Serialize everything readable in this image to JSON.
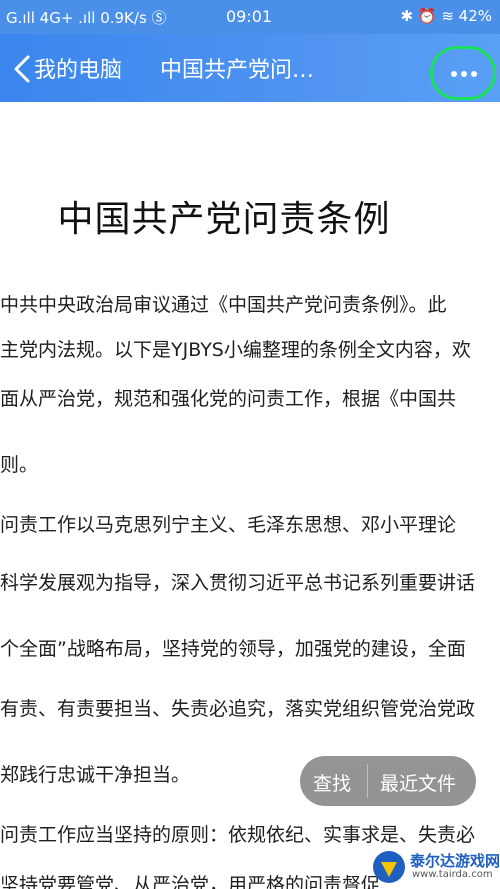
{
  "status_bar": {
    "signal_left": "G.ıll 4G+ .ıll 0.9K/s Ⓢ",
    "time": "09:01",
    "right": "✱ ⏰ ≋ 42%"
  },
  "nav": {
    "back_label": "我的电脑",
    "title": "中国共产党问…",
    "more_icon": "more-dots-icon"
  },
  "document": {
    "title": "中国共产党问责条例",
    "lines": [
      "中共中央政治局审议通过《中国共产党问责条例》。此",
      "主党内法规。以下是YJBYS小编整理的条例全文内容，欢",
      "面从严治党，规范和强化党的问责工作，根据《中国共",
      "则。",
      "问责工作以马克思列宁主义、毛泽东思想、邓小平理论",
      "科学发展观为指导，深入贯彻习近平总书记系列重要讲话",
      "个全面”战略布局，坚持党的领导，加强党的建设，全面",
      "有责、有责要担当、失责必追究，落实党组织管党治党政",
      "郑践行忠诚干净担当。",
      "问责工作应当坚持的原则：依规依纪、实事求是、失责必",
      "坚持党要管党、从严治党，用严格的问责督促"
    ]
  },
  "floating_bar": {
    "find_label": "查找",
    "recent_label": "最近文件"
  },
  "watermark": {
    "name": "泰尔达游戏网",
    "url": "www.tairda.com"
  },
  "colors": {
    "nav_blue": "#4a8fe8",
    "highlight_green": "#19e35a"
  }
}
